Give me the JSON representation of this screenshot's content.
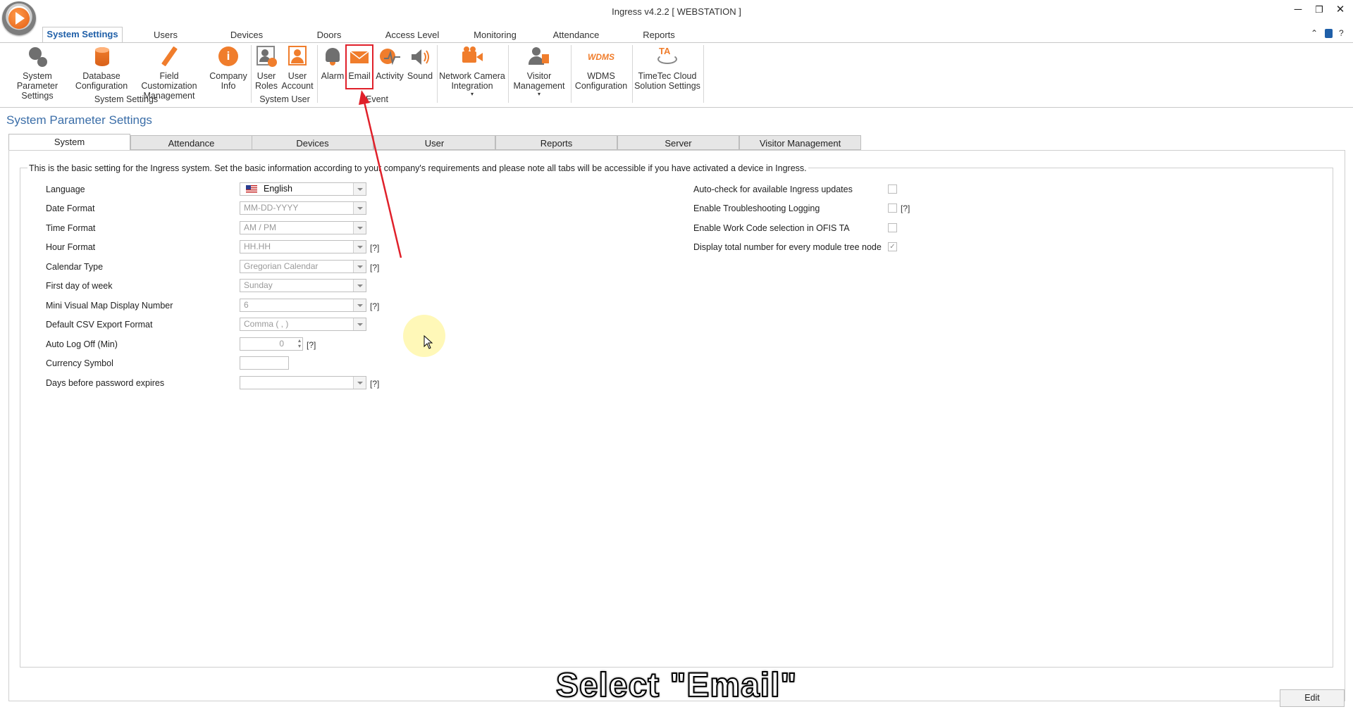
{
  "window": {
    "title": "Ingress v4.2.2 [ WEBSTATION ]",
    "minimize": "─",
    "restore": "❐",
    "close": "✕"
  },
  "ribbon_tabs": [
    "System Settings",
    "Users",
    "Devices",
    "Doors",
    "Access Level",
    "Monitoring",
    "Attendance",
    "Reports"
  ],
  "ribbon": {
    "system_parameter": "System Parameter Settings",
    "database_config": "Database Configuration",
    "field_customization": "Field Customization Management",
    "company_info": "Company Info",
    "user_roles": "User Roles",
    "user_account": "User Account",
    "alarm": "Alarm",
    "email": "Email",
    "activity": "Activity",
    "sound": "Sound",
    "network_camera": "Network Camera Integration",
    "visitor_mgmt": "Visitor Management",
    "wdms_logo": "WDMS",
    "wdms": "WDMS Configuration",
    "timetec_logo": "TA",
    "timetec": "TimeTec Cloud Solution Settings",
    "group_system_settings": "System Settings",
    "group_system_user": "System User",
    "group_event": "Event"
  },
  "page": {
    "title": "System Parameter Settings",
    "tabs": [
      "System",
      "Attendance",
      "Devices",
      "User",
      "Reports",
      "Server",
      "Visitor Management"
    ],
    "intro": "This is the basic setting for the Ingress system. Set the basic information according to your company's requirements and please note all tabs will be accessible if you have activated a device in Ingress."
  },
  "left_fields": [
    {
      "label": "Language",
      "value": "English"
    },
    {
      "label": "Date Format",
      "value": "MM-DD-YYYY"
    },
    {
      "label": "Time Format",
      "value": "AM / PM"
    },
    {
      "label": "Hour Format",
      "value": "HH.HH",
      "help": "[?]"
    },
    {
      "label": "Calendar Type",
      "value": "Gregorian Calendar",
      "help": "[?]"
    },
    {
      "label": "First day of week",
      "value": "Sunday"
    },
    {
      "label": "Mini Visual Map Display Number",
      "value": "6",
      "help": "[?]"
    },
    {
      "label": "Default CSV Export Format",
      "value": "Comma ( , )"
    },
    {
      "label": "Auto Log Off (Min)",
      "value": "0",
      "help": "[?]"
    },
    {
      "label": "Currency Symbol",
      "value": ""
    },
    {
      "label": "Days before password expires",
      "value": "",
      "help": "[?]"
    }
  ],
  "right_fields": [
    {
      "label": "Auto-check for available Ingress updates",
      "checked": false
    },
    {
      "label": "Enable Troubleshooting Logging",
      "checked": false,
      "help": "[?]"
    },
    {
      "label": "Enable Work Code selection in OFIS TA",
      "checked": false
    },
    {
      "label": "Display total number for every module tree node",
      "checked": true,
      "mark": "✓"
    }
  ],
  "buttons": {
    "edit": "Edit"
  },
  "overlay": {
    "caption": "Select \"Email\""
  },
  "colors": {
    "accent": "#1f5fa8",
    "highlight": "#e0202a",
    "icon_orange": "#f07d2c"
  }
}
